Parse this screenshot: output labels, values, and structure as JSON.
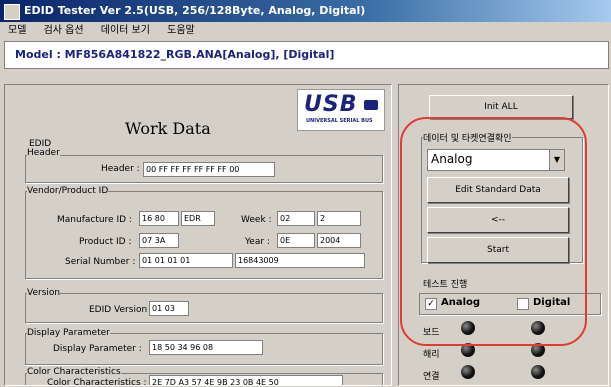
{
  "window": {
    "title": "EDID Tester Ver 2.5(USB, 256/128Byte, Analog, Digital)"
  },
  "menu": [
    "모델",
    "검사 옵션",
    "데이터 보기",
    "도움말"
  ],
  "model_line": "Model : MF856A841822_RGB.ANA[Analog], [Digital]",
  "left": {
    "work_title": "Work Data",
    "usb_logo": {
      "text": "USB",
      "sub": "UNIVERSAL SERIAL BUS"
    },
    "edid_label": "EDID",
    "header_group": {
      "title": "Header",
      "label": "Header :",
      "value": "00 FF FF FF FF FF FF 00"
    },
    "vendor_group": {
      "title": "Vendor/Product ID",
      "manufacture_label": "Manufacture ID :",
      "manufacture_hex": "16 80",
      "manufacture_code": "EDR",
      "week_label": "Week :",
      "week_hex": "02",
      "week_val": "2",
      "product_label": "Product ID :",
      "product_val": "07 3A",
      "year_label": "Year :",
      "year_hex": "0E",
      "year_val": "2004",
      "serial_label": "Serial Number :",
      "serial_hex": "01 01 01 01",
      "serial_val": "16843009"
    },
    "version_group": {
      "title": "Version",
      "label": "EDID Version :",
      "value": "01 03"
    },
    "display_group": {
      "title": "Display Parameter",
      "label": "Display Parameter :",
      "value": "18 50 34 96 08"
    },
    "color_group": {
      "title": "Color Characteristics",
      "label": "Color Characteristics :",
      "value": "2E 7D A3 57 4E 9B 23 0B 4E 50"
    }
  },
  "right": {
    "init_all": "Init ALL",
    "check_group_title": "데이터 및 타켓연결확인",
    "combo_value": "Analog",
    "edit_std": "Edit Standard Data",
    "arrow_btn": "<--",
    "start_btn": "Start",
    "progress_title": "테스트 진행",
    "analog_label": "Analog",
    "digital_label": "Digital",
    "analog_checked": true,
    "digital_checked": false,
    "status_rows": [
      "보드",
      "해리",
      "연결"
    ]
  },
  "colors": {
    "title_bar": "#0a246a",
    "model_text": "#1a237e",
    "annotation": "#e53935"
  }
}
